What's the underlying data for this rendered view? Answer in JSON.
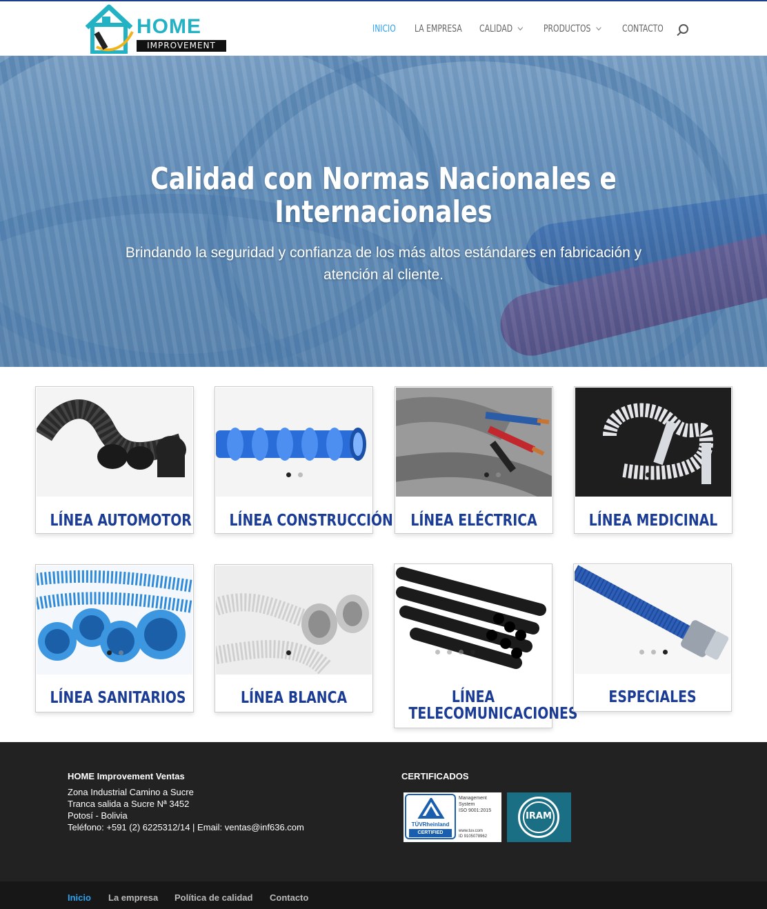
{
  "brand": {
    "word": "HOME",
    "sub": "IMPROVEMENT"
  },
  "nav": [
    {
      "label": "INICIO",
      "active": true,
      "dropdown": false
    },
    {
      "label": "LA EMPRESA",
      "active": false,
      "dropdown": false
    },
    {
      "label": "CALIDAD",
      "active": false,
      "dropdown": true
    },
    {
      "label": "PRODUCTOS",
      "active": false,
      "dropdown": true
    },
    {
      "label": "CONTACTO",
      "active": false,
      "dropdown": false
    }
  ],
  "hero": {
    "title_line1": "Calidad con Normas Nacionales e",
    "title_line2": "Internacionales",
    "subtitle_line1": "Brindando la seguridad y confianza de los más altos estándares en fabricación y",
    "subtitle_line2": "atención al cliente."
  },
  "cards": [
    {
      "title": "LÍNEA AUTOMOTOR"
    },
    {
      "title": "LÍNEA CONSTRUCCIÓN"
    },
    {
      "title": "LÍNEA ELÉCTRICA"
    },
    {
      "title": "LÍNEA MEDICINAL"
    },
    {
      "title": "LÍNEA SANITARIOS"
    },
    {
      "title": "LÍNEA BLANCA"
    },
    {
      "title_line1": "LÍNEA",
      "title_line2": "TELECOMUNICACIONES"
    },
    {
      "title": "ESPECIALES"
    }
  ],
  "footer": {
    "company": "HOME Improvement Ventas",
    "address1": "Zona Industrial Camino a Sucre",
    "address2": "Tranca salida a Sucre Nª 3452",
    "city": "Potosí - Bolivia",
    "contact": "Teléfono: +591 (2) 6225312/14 | Email: ventas@inf636.com",
    "certs_title": "CERTIFICADOS",
    "tuv_brand": "TÜVRheinland",
    "tuv_certified": "CERTIFIED",
    "tuv_mgmt1": "Management",
    "tuv_mgmt2": "System",
    "tuv_iso": "ISO 9001:2015",
    "tuv_url": "www.tuv.com",
    "tuv_id": "ID 9105078962",
    "iram": "IRAM"
  },
  "bottom_nav": [
    {
      "label": "Inicio",
      "active": true
    },
    {
      "label": "La empresa",
      "active": false
    },
    {
      "label": "Política de calidad",
      "active": false
    },
    {
      "label": "Contacto",
      "active": false
    }
  ]
}
